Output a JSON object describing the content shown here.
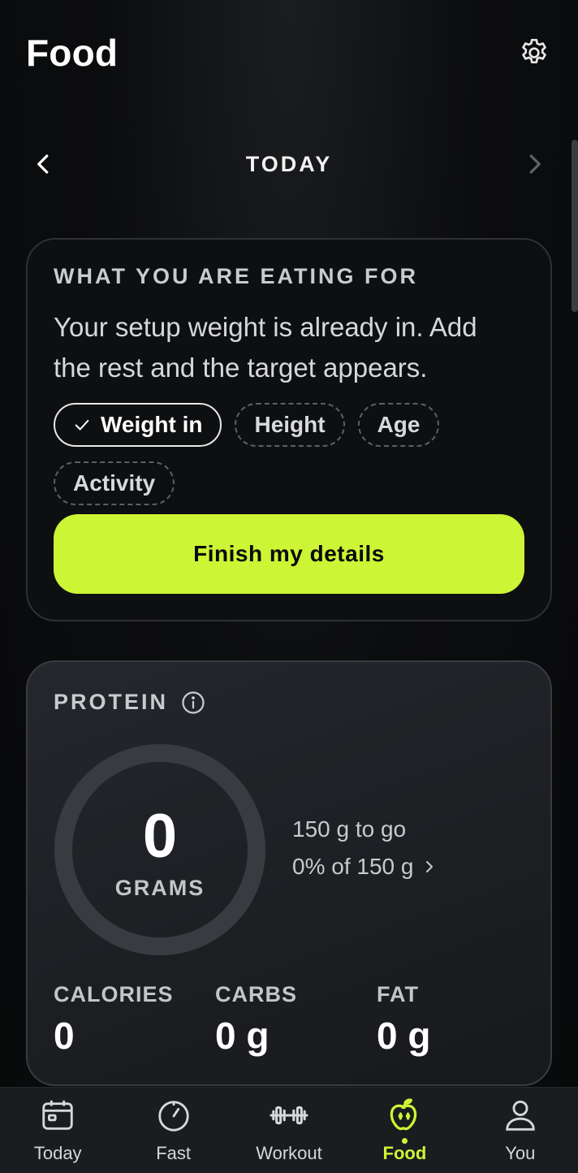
{
  "header": {
    "title": "Food",
    "settings_icon": "gear-icon"
  },
  "date_nav": {
    "label": "TODAY",
    "prev_icon": "chevron-left-icon",
    "next_icon": "chevron-right-icon"
  },
  "setup_card": {
    "title": "WHAT YOU ARE EATING FOR",
    "description": "Your setup weight is already in. Add the rest and the target appears.",
    "chips": [
      {
        "label": "Weight in",
        "done": true
      },
      {
        "label": "Height",
        "done": false
      },
      {
        "label": "Age",
        "done": false
      },
      {
        "label": "Activity",
        "done": false
      }
    ],
    "button_label": "Finish my details"
  },
  "protein_card": {
    "title": "PROTEIN",
    "info_icon": "info-icon",
    "ring_value": "0",
    "ring_unit": "GRAMS",
    "progress": 0,
    "to_go": "150 g to go",
    "percent_of": "0% of 150 g",
    "macros": [
      {
        "label": "CALORIES",
        "value": "0"
      },
      {
        "label": "CARBS",
        "value": "0 g"
      },
      {
        "label": "FAT",
        "value": "0 g"
      }
    ]
  },
  "tabbar": {
    "tabs": [
      {
        "label": "Today",
        "icon": "calendar-icon",
        "active": false
      },
      {
        "label": "Fast",
        "icon": "timer-icon",
        "active": false
      },
      {
        "label": "Workout",
        "icon": "dumbbell-icon",
        "active": false
      },
      {
        "label": "Food",
        "icon": "apple-icon",
        "active": true
      },
      {
        "label": "You",
        "icon": "person-icon",
        "active": false
      }
    ]
  },
  "colors": {
    "accent": "#ccf535",
    "background": "#0c0d0f",
    "card_border": "#2e3034"
  }
}
